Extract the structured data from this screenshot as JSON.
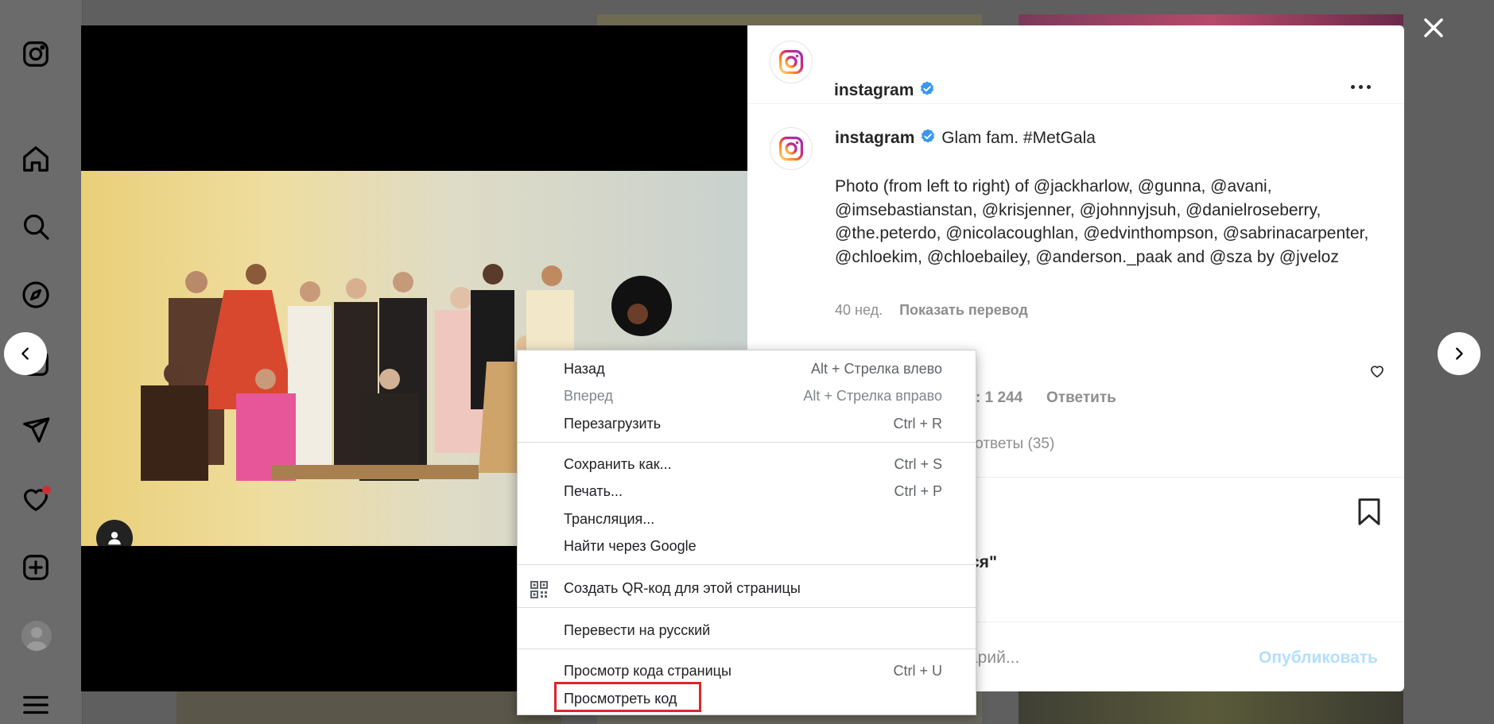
{
  "sidebar": {
    "icons": [
      "instagram-logo-icon",
      "home-icon",
      "search-icon",
      "explore-icon",
      "reels-icon",
      "direct-icon",
      "notifications-icon",
      "create-icon",
      "profile-avatar",
      "menu-icon"
    ]
  },
  "post": {
    "author": "instagram",
    "caption_first": "Glam fam. #MetGala",
    "caption_text": "Photo (from left to right) of @jackharlow, @gunna, @avani, @imsebastianstan, @krisjenner, @johnnyjsuh, @danielroseberry, @the.peterdo, @nicolacoughlan, @edvinthompson, @sabrinacarpenter, @chloekim, @chloebailey, @anderson._paak and @sza by @jveloz",
    "time_ago": "40 нед.",
    "translate_label": "Показать перевод",
    "comment_likes_partial": "\": 1 244",
    "reply_label": "Ответить",
    "replies_partial": "ь ответы (35)",
    "likes_partial": "тся\"",
    "comment_placeholder_partial": "арий...",
    "publish_label": "Опубликовать"
  },
  "context_menu": {
    "items": [
      {
        "label": "Назад",
        "shortcut": "Alt + Стрелка влево",
        "disabled": false
      },
      {
        "label": "Вперед",
        "shortcut": "Alt + Стрелка вправо",
        "disabled": true
      },
      {
        "label": "Перезагрузить",
        "shortcut": "Ctrl + R",
        "disabled": false
      },
      {
        "label": "Сохранить как...",
        "shortcut": "Ctrl + S",
        "disabled": false
      },
      {
        "label": "Печать...",
        "shortcut": "Ctrl + P",
        "disabled": false
      },
      {
        "label": "Трансляция...",
        "shortcut": "",
        "disabled": false
      },
      {
        "label": "Найти через Google",
        "shortcut": "",
        "disabled": false
      },
      {
        "label": "Создать QR-код для этой страницы",
        "shortcut": "",
        "disabled": false
      },
      {
        "label": "Перевести на русский",
        "shortcut": "",
        "disabled": false
      },
      {
        "label": "Просмотр кода страницы",
        "shortcut": "Ctrl + U",
        "disabled": false
      },
      {
        "label": "Просмотреть код",
        "shortcut": "",
        "disabled": false
      }
    ],
    "highlighted_item": "Просмотреть код",
    "highlight_color": "#d8272b"
  },
  "colors": {
    "accent": "#0095f6",
    "link": "#00376b",
    "verified": "#3897f0"
  }
}
